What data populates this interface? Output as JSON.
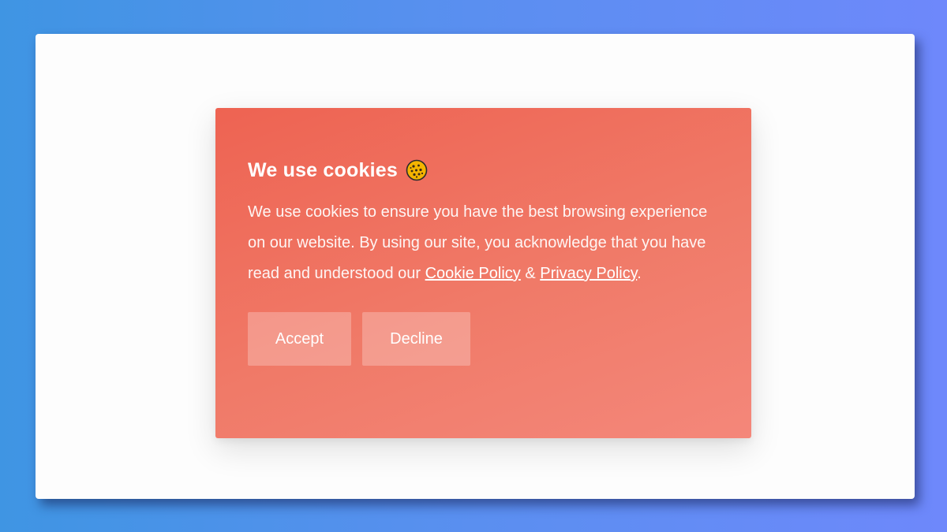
{
  "cookie_banner": {
    "title": "We use cookies",
    "icon": "cookie-icon",
    "body_prefix": "We use cookies to ensure you have the best browsing experience on our website. By using our site, you acknowledge that you have read and understood our ",
    "cookie_policy_link": "Cookie Policy",
    "ampersand": " & ",
    "privacy_policy_link": "Privacy Policy",
    "body_suffix": ".",
    "accept_label": "Accept",
    "decline_label": "Decline"
  },
  "colors": {
    "background_gradient_start": "#3f95e3",
    "background_gradient_end": "#6e88fb",
    "card_gradient_start": "#ee6352",
    "card_gradient_end": "#f4877a",
    "window_background": "#fdfdfd"
  }
}
